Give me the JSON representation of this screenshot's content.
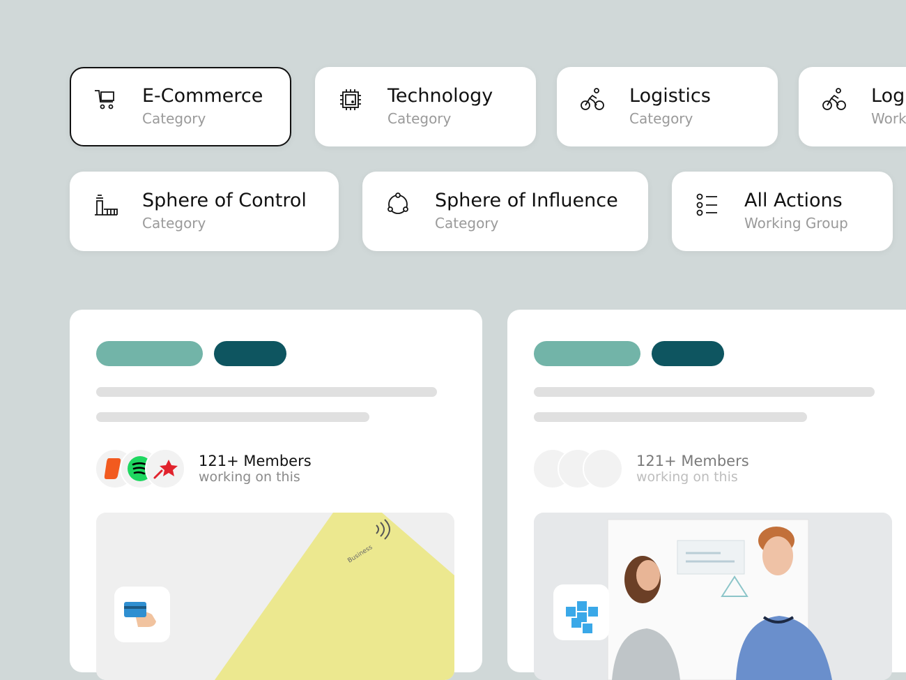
{
  "chips": [
    {
      "title": "E-Commerce",
      "subtitle": "Category",
      "icon": "cart-icon"
    },
    {
      "title": "Technology",
      "subtitle": "Category",
      "icon": "chip-icon"
    },
    {
      "title": "Logistics",
      "subtitle": "Category",
      "icon": "bicycle-icon"
    },
    {
      "title": "Logi",
      "subtitle": "Work",
      "icon": "bicycle-icon"
    },
    {
      "title": "Sphere of Control",
      "subtitle": "Category",
      "icon": "control-tower-icon"
    },
    {
      "title": "Sphere of Influence",
      "subtitle": "Category",
      "icon": "network-circle-icon"
    },
    {
      "title": "All Actions",
      "subtitle": "Working Group",
      "icon": "list-icon"
    }
  ],
  "cards": [
    {
      "members_count": "121+ Members",
      "members_sub": "working on this",
      "image_text": "Business",
      "avatars": [
        "orange-brand-logo",
        "spotify-logo",
        "red-star-logo"
      ],
      "badge_icon": "card-payment-icon"
    },
    {
      "members_count": "121+ Members",
      "members_sub": "working on this",
      "avatars": [
        "placeholder-avatar",
        "placeholder-avatar",
        "placeholder-avatar"
      ],
      "badge_icon": "blocks-cube-icon"
    }
  ],
  "colors": {
    "background": "#d0d8d8",
    "pill_teal": "#72b4a8",
    "pill_dark": "#0e5560"
  }
}
